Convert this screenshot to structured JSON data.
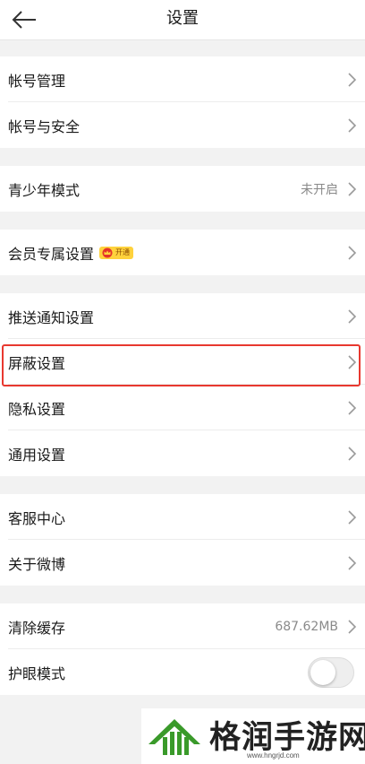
{
  "header": {
    "title": "设置"
  },
  "groups": {
    "account": {
      "manage_label": "帐号管理",
      "security_label": "帐号与安全"
    },
    "youth": {
      "label": "青少年模式",
      "value": "未开启"
    },
    "member": {
      "label": "会员专属设置",
      "badge_text": "开通"
    },
    "prefs": {
      "push_label": "推送通知设置",
      "block_label": "屏蔽设置",
      "privacy_label": "隐私设置",
      "general_label": "通用设置"
    },
    "support": {
      "service_label": "客服中心",
      "about_label": "关于微博"
    },
    "misc": {
      "cache_label": "清除缓存",
      "cache_value": "687.62MB",
      "eye_label": "护眼模式",
      "eye_mode_on": false
    }
  },
  "watermark": {
    "text": "格润手游网",
    "url": "www.hngrjd.com"
  },
  "colors": {
    "highlight": "#e8382f",
    "background": "#f2f2f2",
    "logo_green": "#3a9a2a"
  }
}
